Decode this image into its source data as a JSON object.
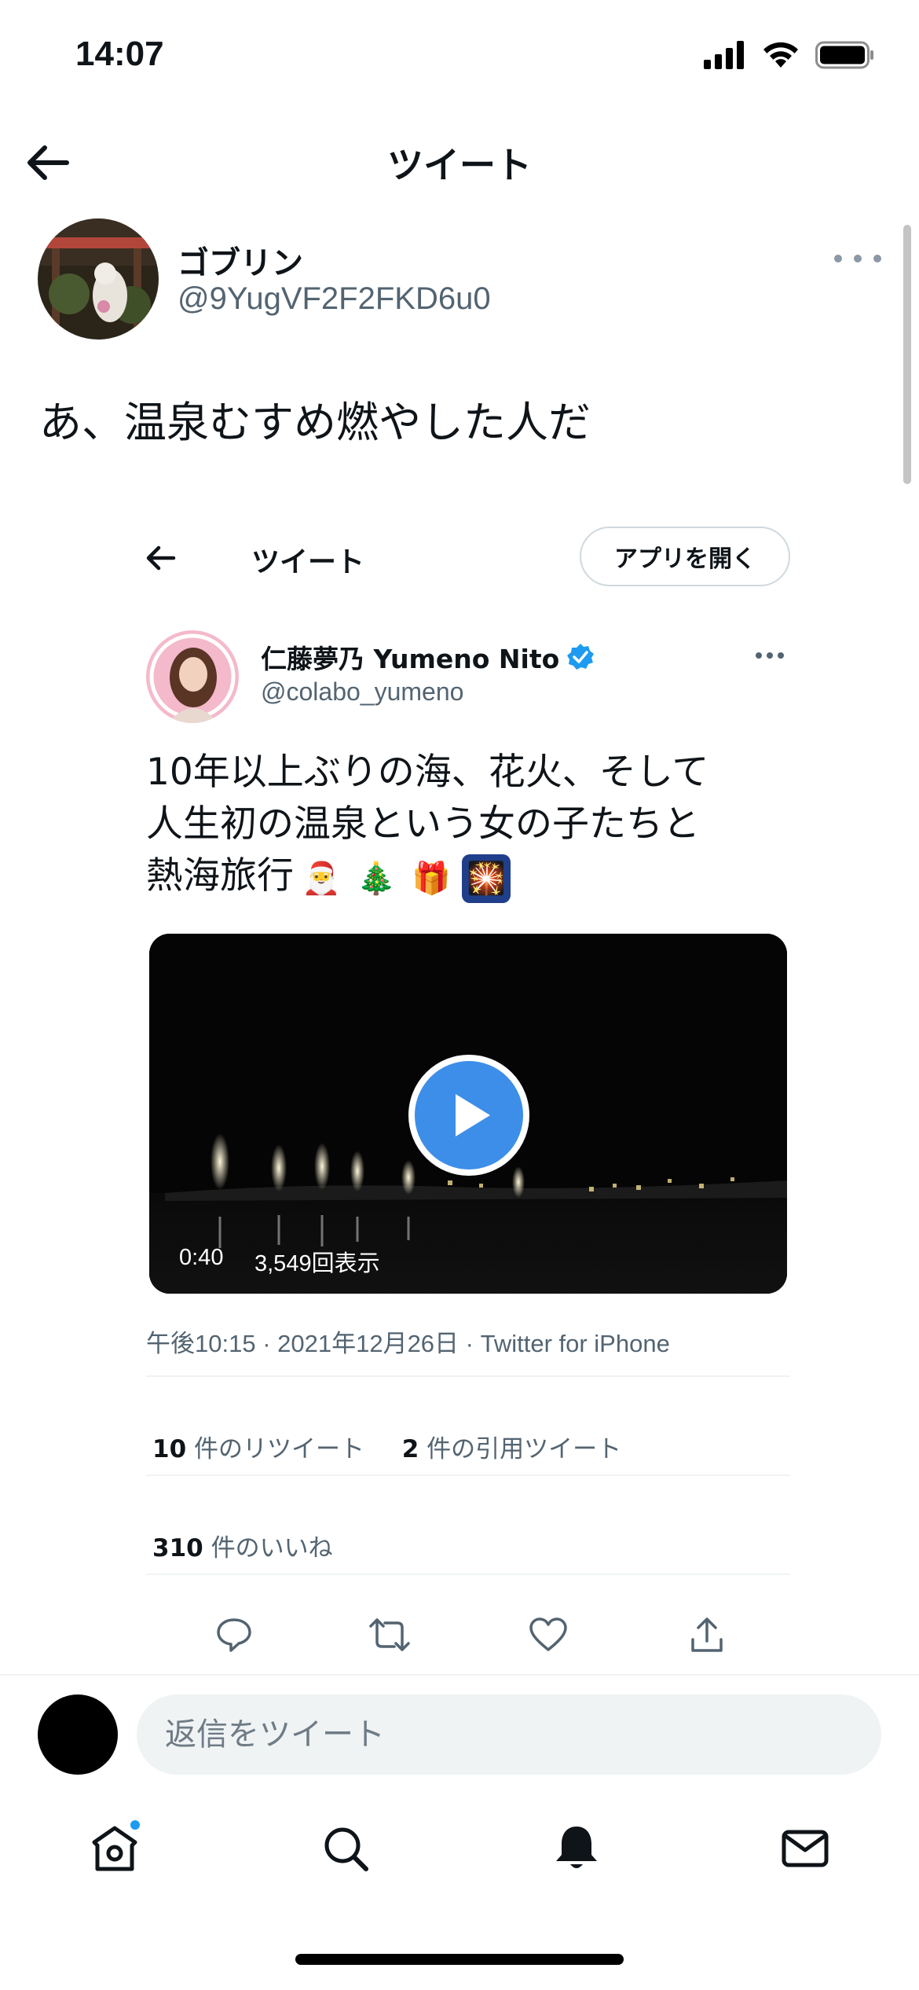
{
  "status": {
    "time": "14:07"
  },
  "header": {
    "title": "ツイート"
  },
  "tweet": {
    "author_name": "ゴブリン",
    "author_handle": "@9YugVF2F2FKD6u0",
    "text": "あ、温泉むすめ燃やした人だ"
  },
  "embedded": {
    "header_title": "ツイート",
    "open_app_label": "アプリを開く",
    "author_name": "仁藤夢乃 Yumeno Nito",
    "author_handle": "@colabo_yumeno",
    "text_line1": "10年以上ぶりの海、花火、そして",
    "text_line2": "人生初の温泉という女の子たちと",
    "text_line3": "熱海旅行",
    "emojis": [
      "🎅",
      "🎄",
      "🎁",
      "🎇"
    ],
    "video_duration": "0:40",
    "video_views": "3,549回表示",
    "meta": "午後10:15 · 2021年12月26日 · Twitter for iPhone",
    "retweets_count": "10",
    "retweets_label": " 件のリツイート",
    "quotes_count": "2",
    "quotes_label": " 件の引用ツイート",
    "likes_count": "310",
    "likes_label": " 件のいいね"
  },
  "reply": {
    "placeholder": "返信をツイート"
  },
  "colors": {
    "accent": "#1d9bf0",
    "text": "#0f1419",
    "secondary": "#536471",
    "divider": "#eff3f4"
  }
}
